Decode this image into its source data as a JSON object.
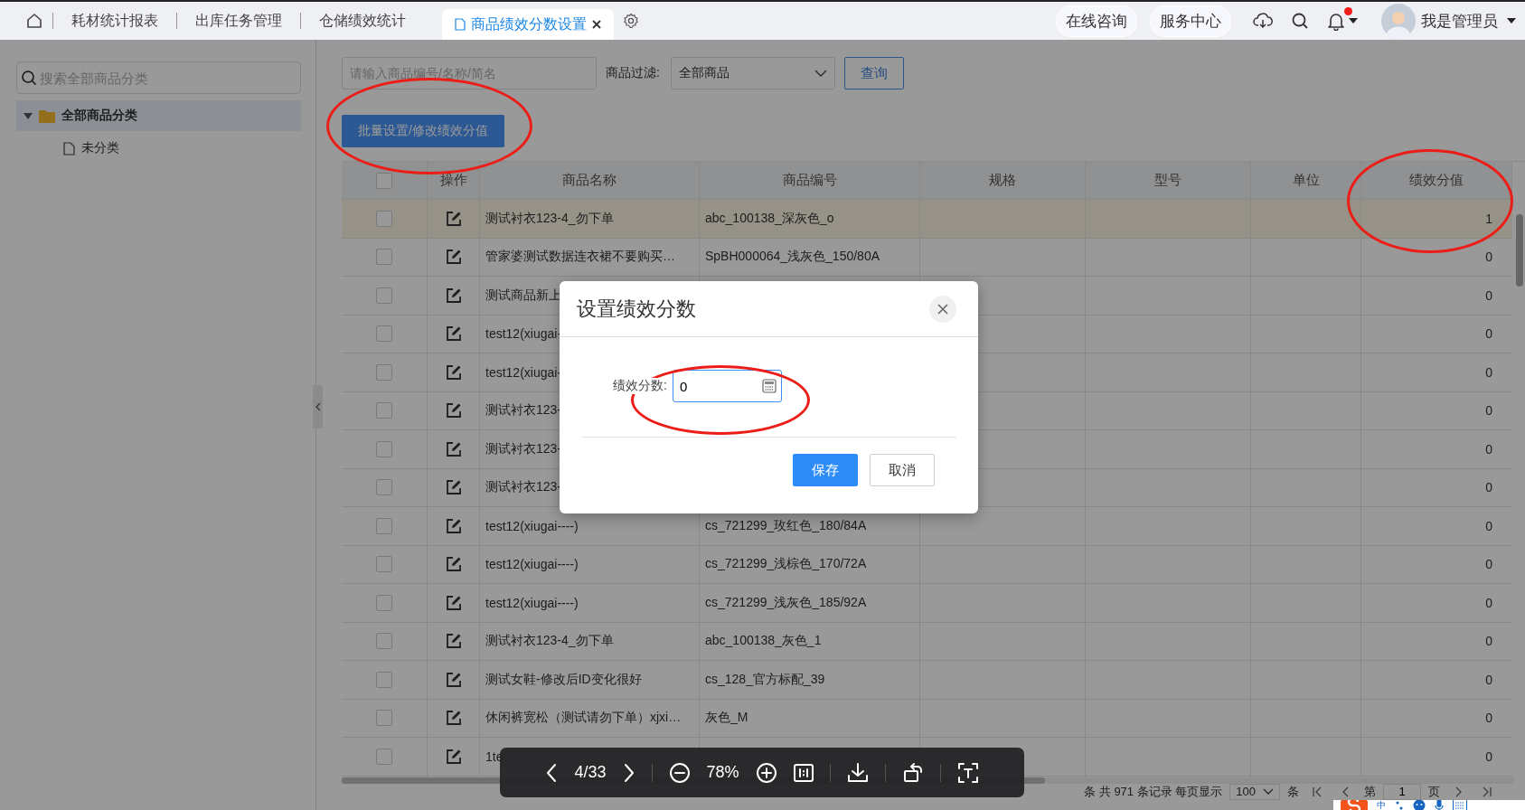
{
  "tabs": [
    {
      "label": "耗材统计报表",
      "selected": false
    },
    {
      "label": "出库任务管理",
      "selected": false
    },
    {
      "label": "仓储绩效统计",
      "selected": false
    },
    {
      "label": "商品绩效分数设置",
      "selected": true
    }
  ],
  "header_links": [
    "在线咨询",
    "服务中心"
  ],
  "notifications": {
    "unread": true
  },
  "user": {
    "name": "我是管理员"
  },
  "sidebar": {
    "search_placeholder": "搜索全部商品分类",
    "tree": [
      {
        "label": "全部商品分类",
        "expanded": true,
        "selected": true,
        "children": [
          {
            "label": "未分类",
            "selected": false
          }
        ]
      }
    ]
  },
  "toolbar": {
    "search_placeholder": "请输入商品编号/名称/简名",
    "filter_label": "商品过滤:",
    "filter_value": "全部商品",
    "query_button": "查询",
    "batch_button": "批量设置/修改绩效分值",
    "batch_circled": true
  },
  "table": {
    "all_checked": false,
    "columns": [
      {
        "label": "操作",
        "circled": false
      },
      {
        "label": "商品名称",
        "circled": false
      },
      {
        "label": "商品编号",
        "circled": false
      },
      {
        "label": "规格",
        "circled": false
      },
      {
        "label": "型号",
        "circled": false
      },
      {
        "label": "单位",
        "circled": false
      },
      {
        "label": "绩效分值",
        "circled": true
      }
    ],
    "rows": [
      {
        "selected": true,
        "checked": false,
        "name": "测试衬衣123-4_勿下单",
        "code": "abc_100138_深灰色_o",
        "score": "1"
      },
      {
        "selected": false,
        "checked": false,
        "name": "管家婆测试数据连衣裙不要购买…",
        "code": "SpBH000064_浅灰色_150/80A",
        "score": "0"
      },
      {
        "selected": false,
        "checked": false,
        "name": "测试商品新上",
        "score": "0"
      },
      {
        "selected": false,
        "checked": false,
        "name": "test12(xiugai-",
        "score": "0"
      },
      {
        "selected": false,
        "checked": false,
        "name": "test12(xiugai-",
        "score": "0"
      },
      {
        "selected": false,
        "checked": false,
        "name": "测试衬衣123-",
        "score": "0"
      },
      {
        "selected": false,
        "checked": false,
        "name": "测试衬衣123-",
        "score": "0"
      },
      {
        "selected": false,
        "checked": false,
        "name": "测试衬衣123-",
        "score": "0"
      },
      {
        "selected": false,
        "checked": false,
        "name": "test12(xiugai----)",
        "code": "cs_721299_玫红色_180/84A",
        "score": "0"
      },
      {
        "selected": false,
        "checked": false,
        "name": "test12(xiugai----)",
        "code": "cs_721299_浅棕色_170/72A",
        "score": "0"
      },
      {
        "selected": false,
        "checked": false,
        "name": "test12(xiugai----)",
        "code": "cs_721299_浅灰色_185/92A",
        "score": "0"
      },
      {
        "selected": false,
        "checked": false,
        "name": "测试衬衣123-4_勿下单",
        "code": "abc_100138_灰色_1",
        "score": "0"
      },
      {
        "selected": false,
        "checked": false,
        "name": "测试女鞋-修改后ID变化很好",
        "code": "cs_128_官方标配_39",
        "score": "0"
      },
      {
        "selected": false,
        "checked": false,
        "name": "休闲裤宽松（测试请勿下单）xjxi…",
        "code": "灰色_M",
        "score": "0"
      },
      {
        "selected": false,
        "checked": false,
        "name": "1te",
        "score": "0"
      }
    ]
  },
  "pagination": {
    "summary": "条 共 971 条记录 每页显示",
    "page_size": "100",
    "unit": "条",
    "page_prefix": "第",
    "page": "1",
    "page_suffix": "页"
  },
  "dialog": {
    "title": "设置绩效分数",
    "field_label": "绩效分数:",
    "field_value": "0",
    "field_circled": true,
    "buttons": [
      {
        "label": "保存",
        "kind": "primary"
      },
      {
        "label": "取消",
        "kind": "default"
      }
    ]
  },
  "viewer": {
    "page": "4/33",
    "zoom": "78%"
  },
  "ime": {
    "label": "中"
  }
}
